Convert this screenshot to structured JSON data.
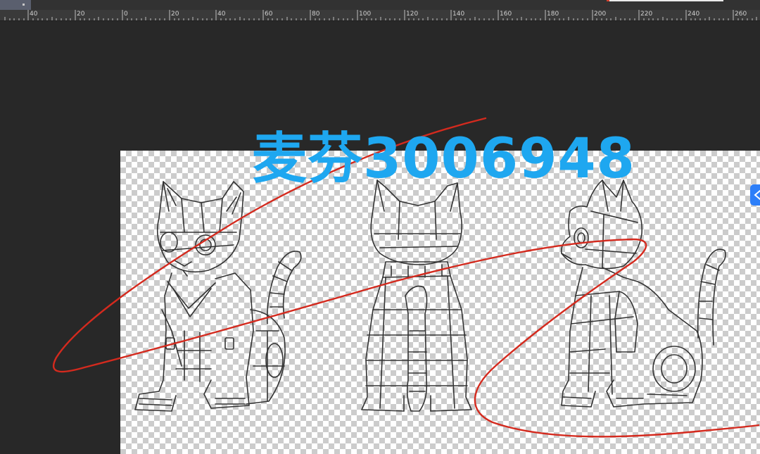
{
  "ruler": {
    "labels": [
      "40",
      "20",
      "0",
      "20",
      "40",
      "60",
      "80",
      "100",
      "120",
      "140",
      "160",
      "180",
      "200",
      "220",
      "240",
      "260"
    ]
  },
  "watermark": {
    "text": "麦芬3006948"
  },
  "canvas": {
    "background": "transparency-checkerboard",
    "checker_color": "#cccccc"
  },
  "drawing": {
    "subjects": [
      "robot-cat-front-three-quarter",
      "robot-cat-back",
      "robot-cat-side"
    ],
    "line_color": "#333333"
  },
  "annotation": {
    "stroke_color": "#d42a1e",
    "type": "freehand-scribble"
  },
  "side_badge": {
    "icon": "share-icon",
    "color": "#2d7ff9"
  }
}
